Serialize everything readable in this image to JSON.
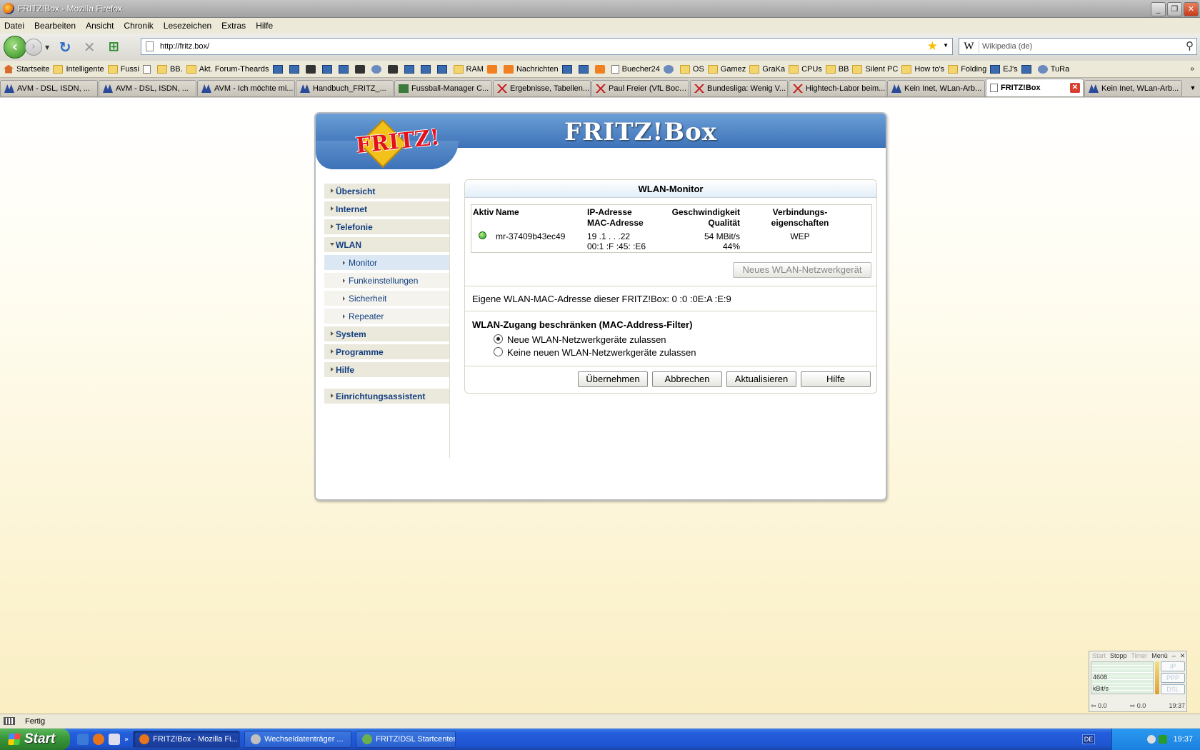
{
  "window": {
    "title": "FRITZ!Box - Mozilla Firefox"
  },
  "menu": [
    "Datei",
    "Bearbeiten",
    "Ansicht",
    "Chronik",
    "Lesezeichen",
    "Extras",
    "Hilfe"
  ],
  "nav": {
    "url": "http://fritz.box/",
    "search_placeholder": "Wikipedia (de)"
  },
  "bookmarks": [
    {
      "label": "Startseite",
      "icon": "house"
    },
    {
      "label": "Intelligente",
      "icon": "folder"
    },
    {
      "label": "Fussi",
      "icon": "folder"
    },
    {
      "label": "",
      "icon": "doc"
    },
    {
      "label": "BB.",
      "icon": "folder"
    },
    {
      "label": "Akt. Forum-Theards",
      "icon": "folder"
    },
    {
      "label": "",
      "icon": "sq"
    },
    {
      "label": "",
      "icon": "sq"
    },
    {
      "label": "",
      "icon": "dark"
    },
    {
      "label": "",
      "icon": "sq"
    },
    {
      "label": "",
      "icon": "sq"
    },
    {
      "label": "",
      "icon": "dark"
    },
    {
      "label": "",
      "icon": "round"
    },
    {
      "label": "",
      "icon": "dark"
    },
    {
      "label": "",
      "icon": "sq"
    },
    {
      "label": "",
      "icon": "sq"
    },
    {
      "label": "",
      "icon": "sq"
    },
    {
      "label": "RAM",
      "icon": "folder"
    },
    {
      "label": "",
      "icon": "rss"
    },
    {
      "label": "Nachrichten",
      "icon": "rss"
    },
    {
      "label": "",
      "icon": "sq"
    },
    {
      "label": "",
      "icon": "sq"
    },
    {
      "label": "",
      "icon": "rss"
    },
    {
      "label": "Buecher24",
      "icon": "doc"
    },
    {
      "label": "",
      "icon": "round"
    },
    {
      "label": "OS",
      "icon": "folder"
    },
    {
      "label": "Gamez",
      "icon": "folder"
    },
    {
      "label": "GraKa",
      "icon": "folder"
    },
    {
      "label": "CPUs",
      "icon": "folder"
    },
    {
      "label": "BB",
      "icon": "folder"
    },
    {
      "label": "Silent PC",
      "icon": "folder"
    },
    {
      "label": "How to's",
      "icon": "folder"
    },
    {
      "label": "Folding",
      "icon": "folder"
    },
    {
      "label": "EJ's",
      "icon": "sq"
    },
    {
      "label": "",
      "icon": "sq"
    },
    {
      "label": "TuRa",
      "icon": "round"
    }
  ],
  "tabs": [
    {
      "label": "AVM - DSL, ISDN, ...",
      "icon": "avm"
    },
    {
      "label": "AVM - DSL, ISDN, ...",
      "icon": "avm"
    },
    {
      "label": "AVM - Ich möchte mi...",
      "icon": "avm"
    },
    {
      "label": "Handbuch_FRITZ_...",
      "icon": "avm"
    },
    {
      "label": "Fussball-Manager C...",
      "icon": "grn"
    },
    {
      "label": "Ergebnisse, Tabellen...",
      "icon": "red"
    },
    {
      "label": "Paul Freier (VfL Boch...",
      "icon": "red"
    },
    {
      "label": "Bundesliga: Wenig V...",
      "icon": "red"
    },
    {
      "label": "Hightech-Labor beim...",
      "icon": "red"
    },
    {
      "label": "Kein Inet, WLan-Arb...",
      "icon": "avm"
    },
    {
      "label": "FRITZ!Box",
      "icon": "doc",
      "active": true
    },
    {
      "label": "Kein Inet, WLan-Arb...",
      "icon": "avm"
    }
  ],
  "page": {
    "brand": "FRITZ!Box",
    "logo_text": "FRITZ!",
    "sidebar": {
      "overview": "Übersicht",
      "internet": "Internet",
      "telefonie": "Telefonie",
      "wlan": "WLAN",
      "monitor": "Monitor",
      "funk": "Funkeinstellungen",
      "sicherheit": "Sicherheit",
      "repeater": "Repeater",
      "system": "System",
      "programme": "Programme",
      "hilfe": "Hilfe",
      "assistent": "Einrichtungsassistent"
    },
    "panel": {
      "title": "WLAN-Monitor",
      "col_aktiv": "Aktiv",
      "col_name": "Name",
      "col_ip": "IP-Adresse",
      "col_mac": "MAC-Adresse",
      "col_speed": "Geschwindigkeit",
      "col_quality": "Qualität",
      "col_conn1": "Verbindungs-",
      "col_conn2": "eigenschaften",
      "device_name": "mr-37409b43ec49",
      "device_ip": "19 .1 . .  .22",
      "device_mac": "00:1 :F  :45: :E6",
      "device_speed": "54 MBit/s",
      "device_quality": "44%",
      "device_conn": "WEP",
      "new_device_btn": "Neues WLAN-Netzwerkgerät",
      "own_mac_label": "Eigene WLAN-MAC-Adresse dieser FRITZ!Box:",
      "own_mac_value": "0 :0 :0E:A :E:9",
      "filter_title": "WLAN-Zugang beschränken (MAC-Address-Filter)",
      "opt_allow": "Neue WLAN-Netzwerkgeräte zulassen",
      "opt_deny": "Keine neuen WLAN-Netzwerkgeräte zulassen",
      "btn_apply": "Übernehmen",
      "btn_cancel": "Abbrechen",
      "btn_refresh": "Aktualisieren",
      "btn_help": "Hilfe"
    }
  },
  "status": {
    "text": "Fertig"
  },
  "taskbar": {
    "start": "Start",
    "items": [
      {
        "label": "FRITZ!Box - Mozilla Fi...",
        "active": true,
        "color": "#e8741c"
      },
      {
        "label": "Wechseldatenträger ...",
        "active": false,
        "color": "#c0c0c0"
      },
      {
        "label": "FRITZ!DSL Startcenter",
        "active": false,
        "color": "#6ab04c"
      }
    ],
    "lang": "DE",
    "clock": "19:37"
  },
  "widget": {
    "btn_start": "Start",
    "btn_stop": "Stopp",
    "btn_timer": "Timer",
    "menu": "Menü",
    "scale": "4608",
    "unit": "kBit/s",
    "ip": "IP",
    "ppp": "PPP",
    "dsl": "DSL",
    "down": "0.0",
    "up": "0.0",
    "time": "19:37"
  }
}
